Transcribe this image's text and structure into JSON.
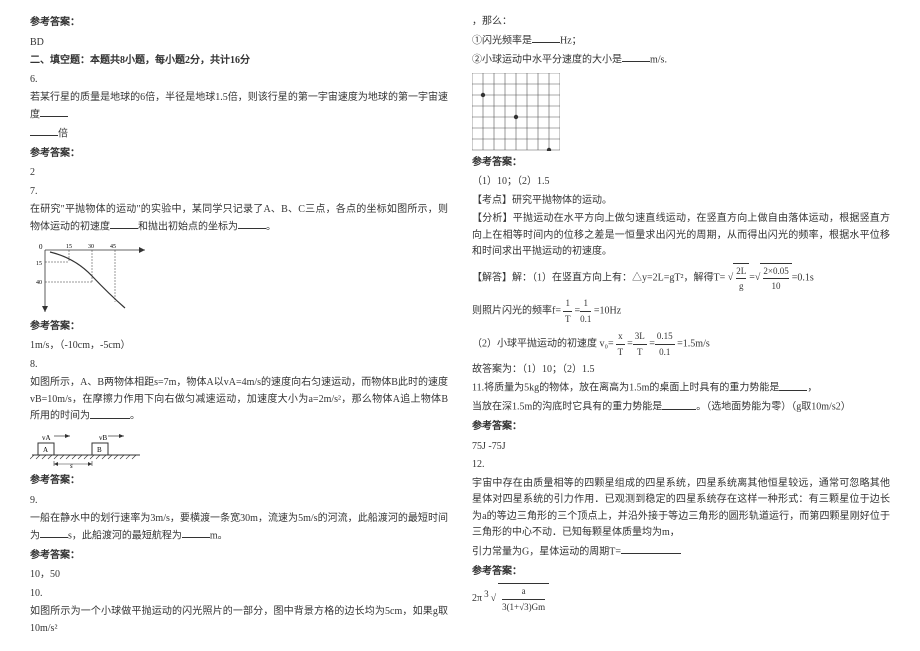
{
  "col1": {
    "ans_label": "参考答案：",
    "ans5": "BD",
    "section2_title": "二、填空题：本题共8小题，每小题2分，共计16分",
    "q6": {
      "text": "若某行星的质量是地球的6倍，半径是地球1.5倍，则该行星的第一宇宙速度为地球的第一宇宙速度",
      "suffix": "倍",
      "ans": "2"
    },
    "q7": {
      "text": "在研究\"平抛物体的运动\"的实验中，某同学只记录了A、B、C三点，各点的坐标如图所示，则物体运动的初速度",
      "mid": "和抛出初始点的坐标为",
      "period": "。",
      "ans": "1m/s，（-10cm，-5cm）"
    },
    "q8": {
      "line1": "如图所示，A、B两物体相距s=7m，物体A以vA=4m/s的速度向右匀速运动，而物体B此时的速度vB=10m/s，在摩擦力作用下向右做匀减速运动，加速度大小为a=2m/s²，那么物体A追上物体B所用的时间为",
      "period": "。"
    },
    "q9": {
      "line1": "一船在静水中的划行速率为3m/s，要横渡一条宽30m，流速为5m/s的河流，此船渡河的最短时间为",
      "mid": "s，此船渡河的最短航程为",
      "end": "m。",
      "ans": "10，50"
    },
    "q10": {
      "line1": "如图所示为一个小球做平抛运动的闪光照片的一部分，图中背景方格的边长均为5cm，如果g取10m/s²"
    },
    "num6": "6.",
    "num7": "7.",
    "num8": "8.",
    "num9": "9.",
    "num10": "10."
  },
  "col2": {
    "cont": {
      "line1": "，那么：",
      "line2": "①闪光频率是",
      "line2b": "Hz；",
      "line3": "②小球运动中水平分速度的大小是",
      "line3b": "m/s."
    },
    "ans10": {
      "a": "（1）10；（2）1.5",
      "kd": "【考点】研究平抛物体的运动。",
      "fx": "【分析】平抛运动在水平方向上做匀速直线运动，在竖直方向上做自由落体运动，根据竖直方向上在相等时间内的位移之差是一恒量求出闪光的周期，从而得出闪光的频率，根据水平位移和时间求出平抛运动的初速度。",
      "solve_lead": "【解答】解：（1）在竖直方向上有：△y=2L=gT²，解得T=",
      "sqrt_num": "2L",
      "sqrt_den": "g",
      "sqrt2_num": "2×0.05",
      "sqrt2_den": "10",
      "sqrt_res": "=0.1s",
      "line_freq": "则照片闪光的频率f=",
      "freq_frac": "1",
      "freq_den": "T",
      "freq2_num": "1",
      "freq2_den": "0.1",
      "freq_res": "=10Hz",
      "line_v": "（2）小球平抛运动的初速度",
      "v0_sym": "v₀=",
      "v_num": "x",
      "v_den": "T",
      "v2_num": "3L",
      "v2_den": "T",
      "v3_num": "0.15",
      "v3_den": "0.1",
      "v_res": "=1.5m/s",
      "final": "故答案为：（1）10；（2）1.5"
    },
    "q11": {
      "line1": "11.将质量为5kg的物体，放在离高为1.5m的桌面上时具有的重力势能是",
      "line2": "当放在深1.5m的沟底时它具有的重力势能是",
      "line2b": "。（选地面势能为零）（g取10m/s2）",
      "ans": "75J   -75J"
    },
    "q12": {
      "num": "12.",
      "line1": "宇宙中存在由质量相等的四颗星组成的四星系统，四星系统离其他恒星较远，通常可忽略其他星体对四星系统的引力作用．已观测到稳定的四星系统存在这样一种形式：有三颗星位于边长为a的等边三角形的三个顶点上，并沿外接于等边三角形的圆形轨道运行，而第四颗星刚好位于三角形的中心不动．已知每颗星体质量均为m，",
      "line2": "引力常量为G，星体运动的周期T=",
      "formula_top": "a",
      "formula_bot": "3(1+√3)Gm",
      "ans_prefix": "2π"
    },
    "ans_label": "参考答案："
  }
}
